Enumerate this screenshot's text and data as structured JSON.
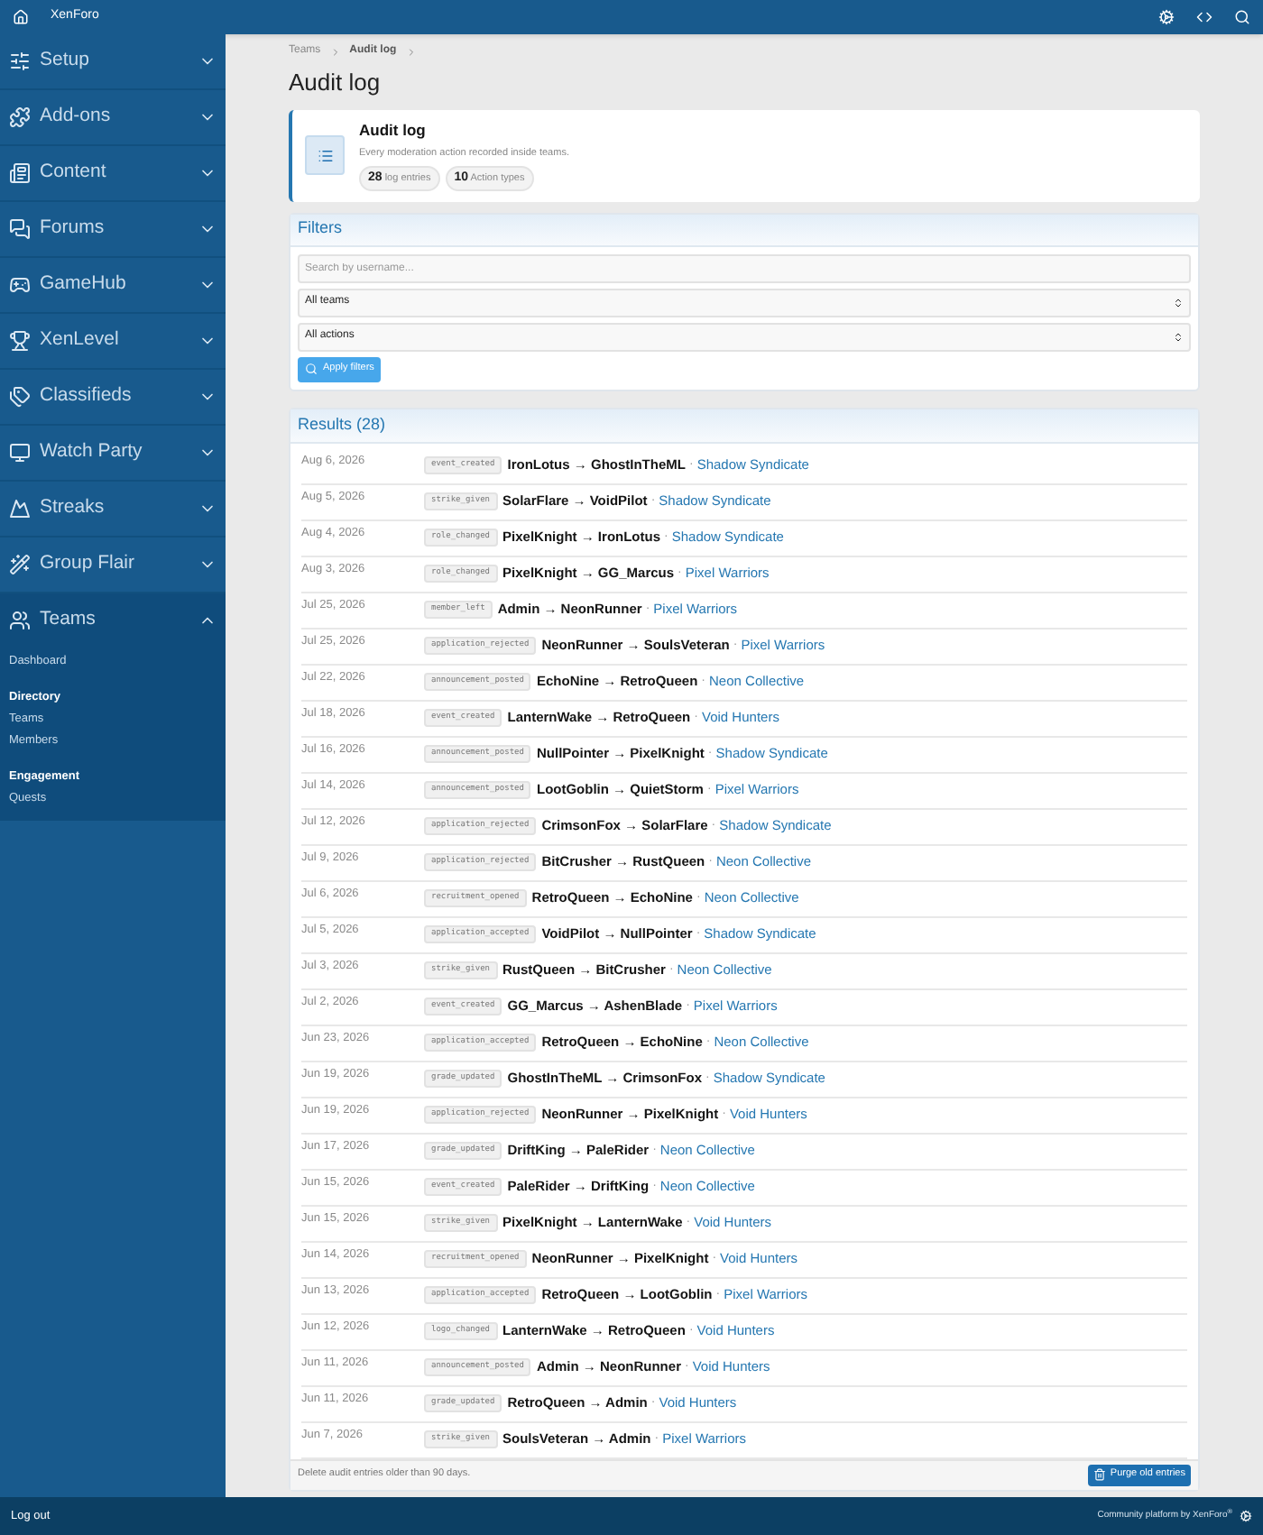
{
  "header": {
    "title": "XenForo"
  },
  "sidebar": {
    "items": [
      {
        "label": "Setup",
        "expanded": false
      },
      {
        "label": "Add-ons",
        "expanded": false
      },
      {
        "label": "Content",
        "expanded": false
      },
      {
        "label": "Forums",
        "expanded": false
      },
      {
        "label": "GameHub",
        "expanded": false
      },
      {
        "label": "XenLevel",
        "expanded": false
      },
      {
        "label": "Classifieds",
        "expanded": false
      },
      {
        "label": "Watch Party",
        "expanded": false
      },
      {
        "label": "Streaks",
        "expanded": false
      },
      {
        "label": "Group Flair",
        "expanded": false
      },
      {
        "label": "Teams",
        "expanded": true,
        "children": [
          {
            "kind": "link",
            "label": "Dashboard"
          },
          {
            "kind": "heading",
            "label": "Directory"
          },
          {
            "kind": "link",
            "label": "Teams"
          },
          {
            "kind": "link",
            "label": "Members"
          },
          {
            "kind": "heading",
            "label": "Engagement"
          },
          {
            "kind": "link",
            "label": "Quests"
          }
        ]
      }
    ]
  },
  "breadcrumb": [
    "Teams",
    "Audit log"
  ],
  "page_title": "Audit log",
  "summary": {
    "title": "Audit log",
    "description": "Every moderation action recorded inside teams.",
    "stats": [
      {
        "value": "28",
        "label": "log entries"
      },
      {
        "value": "10",
        "label": "Action types"
      }
    ]
  },
  "filters": {
    "title": "Filters",
    "search": {
      "placeholder": "Search by username..."
    },
    "selects": [
      "All teams",
      "All actions"
    ],
    "apply": "Apply filters"
  },
  "results": {
    "title": "Results (28)",
    "rows": [
      {
        "date": "Aug 6, 2026",
        "action": "event_created",
        "users": "IronLotus → GhostInTheML",
        "separator": "·",
        "team": "Shadow Syndicate"
      },
      {
        "date": "Aug 5, 2026",
        "action": "strike_given",
        "users": "SolarFlare → VoidPilot",
        "separator": "·",
        "team": "Shadow Syndicate"
      },
      {
        "date": "Aug 4, 2026",
        "action": "role_changed",
        "users": "PixelKnight → IronLotus",
        "separator": "·",
        "team": "Shadow Syndicate"
      },
      {
        "date": "Aug 3, 2026",
        "action": "role_changed",
        "users": "PixelKnight → GG_Marcus",
        "separator": "·",
        "team": "Pixel Warriors"
      },
      {
        "date": "Jul 25, 2026",
        "action": "member_left",
        "users": "Admin → NeonRunner",
        "separator": "·",
        "team": "Pixel Warriors"
      },
      {
        "date": "Jul 25, 2026",
        "action": "application_rejected",
        "users": "NeonRunner → SoulsVeteran",
        "separator": "·",
        "team": "Pixel Warriors"
      },
      {
        "date": "Jul 22, 2026",
        "action": "announcement_posted",
        "users": "EchoNine → RetroQueen",
        "separator": "·",
        "team": "Neon Collective"
      },
      {
        "date": "Jul 18, 2026",
        "action": "event_created",
        "users": "LanternWake → RetroQueen",
        "separator": "·",
        "team": "Void Hunters"
      },
      {
        "date": "Jul 16, 2026",
        "action": "announcement_posted",
        "users": "NullPointer → PixelKnight",
        "separator": "·",
        "team": "Shadow Syndicate"
      },
      {
        "date": "Jul 14, 2026",
        "action": "announcement_posted",
        "users": "LootGoblin → QuietStorm",
        "separator": "·",
        "team": "Pixel Warriors"
      },
      {
        "date": "Jul 12, 2026",
        "action": "application_rejected",
        "users": "CrimsonFox → SolarFlare",
        "separator": "·",
        "team": "Shadow Syndicate"
      },
      {
        "date": "Jul 9, 2026",
        "action": "application_rejected",
        "users": "BitCrusher → RustQueen",
        "separator": "·",
        "team": "Neon Collective"
      },
      {
        "date": "Jul 6, 2026",
        "action": "recruitment_opened",
        "users": "RetroQueen → EchoNine",
        "separator": "·",
        "team": "Neon Collective"
      },
      {
        "date": "Jul 5, 2026",
        "action": "application_accepted",
        "users": "VoidPilot → NullPointer",
        "separator": "·",
        "team": "Shadow Syndicate"
      },
      {
        "date": "Jul 3, 2026",
        "action": "strike_given",
        "users": "RustQueen → BitCrusher",
        "separator": "·",
        "team": "Neon Collective"
      },
      {
        "date": "Jul 2, 2026",
        "action": "event_created",
        "users": "GG_Marcus → AshenBlade",
        "separator": "·",
        "team": "Pixel Warriors"
      },
      {
        "date": "Jun 23, 2026",
        "action": "application_accepted",
        "users": "RetroQueen → EchoNine",
        "separator": "·",
        "team": "Neon Collective"
      },
      {
        "date": "Jun 19, 2026",
        "action": "grade_updated",
        "users": "GhostInTheML → CrimsonFox",
        "separator": "·",
        "team": "Shadow Syndicate"
      },
      {
        "date": "Jun 19, 2026",
        "action": "application_rejected",
        "users": "NeonRunner → PixelKnight",
        "separator": "·",
        "team": "Void Hunters"
      },
      {
        "date": "Jun 17, 2026",
        "action": "grade_updated",
        "users": "DriftKing → PaleRider",
        "separator": "·",
        "team": "Neon Collective"
      },
      {
        "date": "Jun 15, 2026",
        "action": "event_created",
        "users": "PaleRider → DriftKing",
        "separator": "·",
        "team": "Neon Collective"
      },
      {
        "date": "Jun 15, 2026",
        "action": "strike_given",
        "users": "PixelKnight → LanternWake",
        "separator": "·",
        "team": "Void Hunters"
      },
      {
        "date": "Jun 14, 2026",
        "action": "recruitment_opened",
        "users": "NeonRunner → PixelKnight",
        "separator": "·",
        "team": "Void Hunters"
      },
      {
        "date": "Jun 13, 2026",
        "action": "application_accepted",
        "users": "RetroQueen → LootGoblin",
        "separator": "·",
        "team": "Pixel Warriors"
      },
      {
        "date": "Jun 12, 2026",
        "action": "logo_changed",
        "users": "LanternWake → RetroQueen",
        "separator": "·",
        "team": "Void Hunters"
      },
      {
        "date": "Jun 11, 2026",
        "action": "announcement_posted",
        "users": "Admin → NeonRunner",
        "separator": "·",
        "team": "Void Hunters"
      },
      {
        "date": "Jun 11, 2026",
        "action": "grade_updated",
        "users": "RetroQueen → Admin",
        "separator": "·",
        "team": "Void Hunters"
      },
      {
        "date": "Jun 7, 2026",
        "action": "strike_given",
        "users": "SoulsVeteran → Admin",
        "separator": "·",
        "team": "Pixel Warriors"
      }
    ],
    "footer_note": "Delete audit entries older than 90 days.",
    "purge": "Purge old entries"
  },
  "footer": {
    "logout": "Log out",
    "credit": "Community platform by XenForo$^{®}$"
  }
}
